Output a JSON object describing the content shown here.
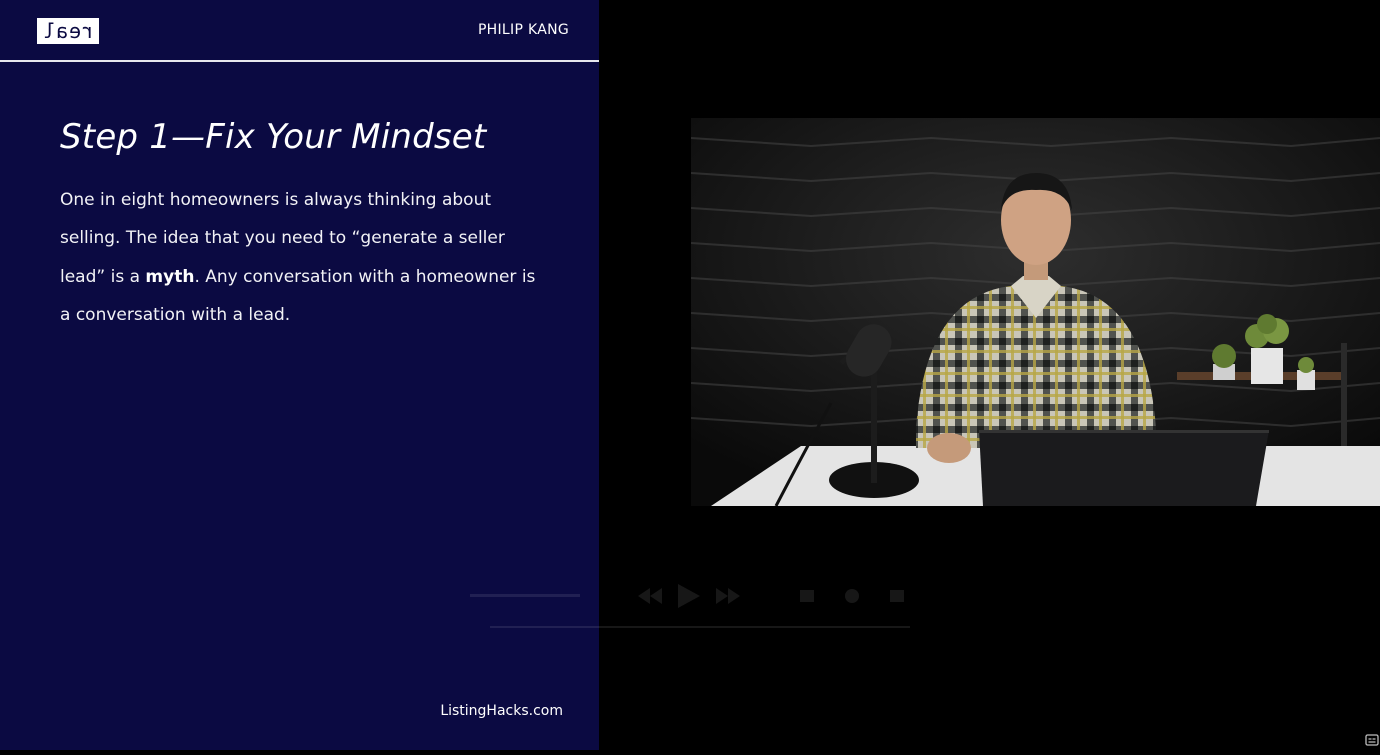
{
  "slide": {
    "logo_text": "real",
    "presenter_name": "PHILIP KANG",
    "title": "Step 1—Fix Your Mindset",
    "body": {
      "part1": "One in eight homeowners is always thinking about selling. The idea that you need to “generate a seller lead” is a ",
      "emphasis": "myth",
      "part2": ". Any conversation with a homeowner is a conversation with a lead."
    },
    "footer": "ListingHacks.com"
  },
  "colors": {
    "slide_background": "#0b0a42",
    "page_background": "#000000",
    "text": "#ffffff"
  },
  "video": {
    "scene": "presenter-at-desk-with-microphone-laptop-and-plants"
  },
  "player_controls": {
    "icons": [
      "rewind-icon",
      "play-icon",
      "fast-forward-icon",
      "volume-icon",
      "settings-icon",
      "fullscreen-icon"
    ],
    "visibility": "faded"
  },
  "corner_icon": "caption-toggle-icon"
}
